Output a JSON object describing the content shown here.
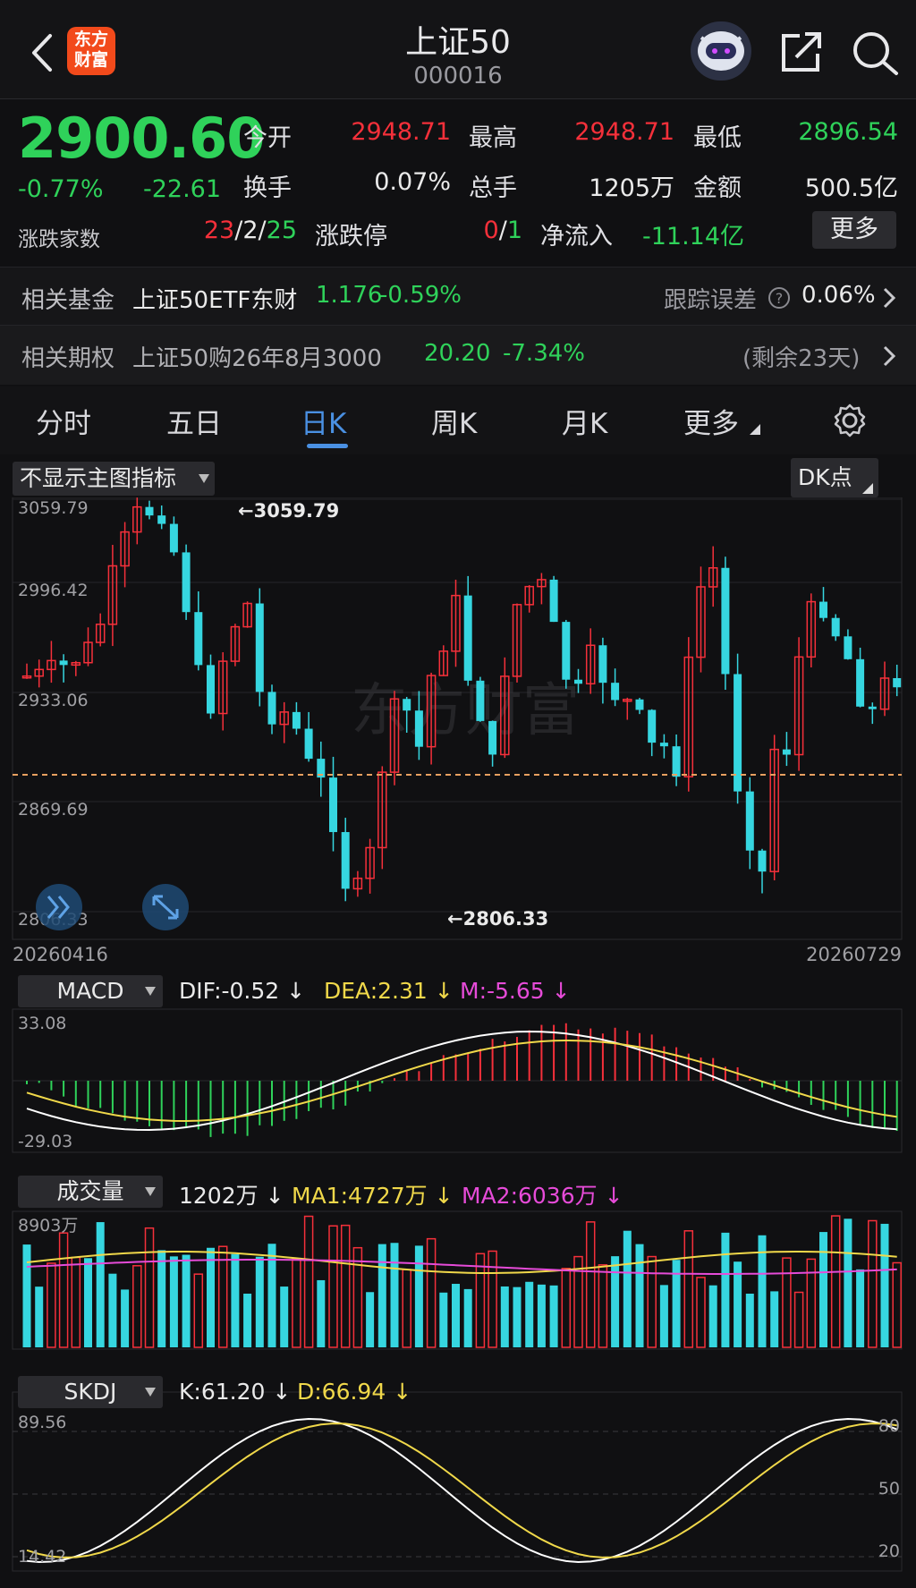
{
  "header": {
    "title": "上证50",
    "code": "000016",
    "logo_line1": "东方",
    "logo_line2": "财富"
  },
  "quote": {
    "price": "2900.60",
    "change_pct": "-0.77%",
    "change": "-22.61",
    "open_label": "今开",
    "open": "2948.71",
    "high_label": "最高",
    "high": "2948.71",
    "low_label": "最低",
    "low": "2896.54",
    "turnover_label": "换手",
    "turnover": "0.07%",
    "volume_label": "总手",
    "volume": "1205万",
    "amount_label": "金额",
    "amount": "500.5亿",
    "breadth_label": "涨跌家数",
    "breadth_up": "23",
    "breadth_flat": "2",
    "breadth_down": "25",
    "limit_label": "涨跌停",
    "limit_up": "0",
    "limit_down": "1",
    "inflow_label": "净流入",
    "inflow": "-11.14亿",
    "more_label": "更多"
  },
  "related_fund": {
    "label": "相关基金",
    "name": "上证50ETF东财",
    "price": "1.176",
    "change": "-0.59%",
    "tracking_label": "跟踪误差",
    "tracking": "0.06%"
  },
  "related_option": {
    "label": "相关期权",
    "name": "上证50购26年8月3000",
    "price": "20.20",
    "change": "-7.34%",
    "remain": "(剩余23天)"
  },
  "tabs": [
    "分时",
    "五日",
    "日K",
    "周K",
    "月K",
    "更多"
  ],
  "active_tab": 2,
  "main_chart": {
    "indicator_dropdown": "不显示主图指标",
    "dk_button": "DK点",
    "y_labels": [
      "3059.79",
      "2996.42",
      "2933.06",
      "2869.69",
      "2806.33"
    ],
    "high_annotation": "←3059.79",
    "low_annotation": "←2806.33",
    "date_start": "20260416",
    "date_end": "20260729",
    "watermark": "东方财富"
  },
  "macd": {
    "dropdown": "MACD",
    "dif": "DIF:-0.52 ↓",
    "dea": "DEA:2.31 ↓",
    "m": "M:-5.65 ↓",
    "y_top": "33.08",
    "y_bottom": "-29.03"
  },
  "volume_panel": {
    "dropdown": "成交量",
    "vol": "1202万 ↓",
    "ma1": "MA1:4727万 ↓",
    "ma2": "MA2:6036万 ↓",
    "y_top": "8903万"
  },
  "skdj": {
    "dropdown": "SKDJ",
    "k": "K:61.20 ↓",
    "d": "D:66.94 ↓",
    "y_top": "89.56",
    "y_bottom": "14.42",
    "levels": [
      "80",
      "50",
      "20"
    ]
  },
  "colors": {
    "up": "#f5303a",
    "down": "#2fd25a",
    "candle_down_fill": "#36d6e0",
    "accent": "#4a90e2",
    "price_line": "#e8a060",
    "dif_line": "#ffffff",
    "dea_line": "#f0d84a",
    "ma2_line": "#e64bd8"
  }
}
